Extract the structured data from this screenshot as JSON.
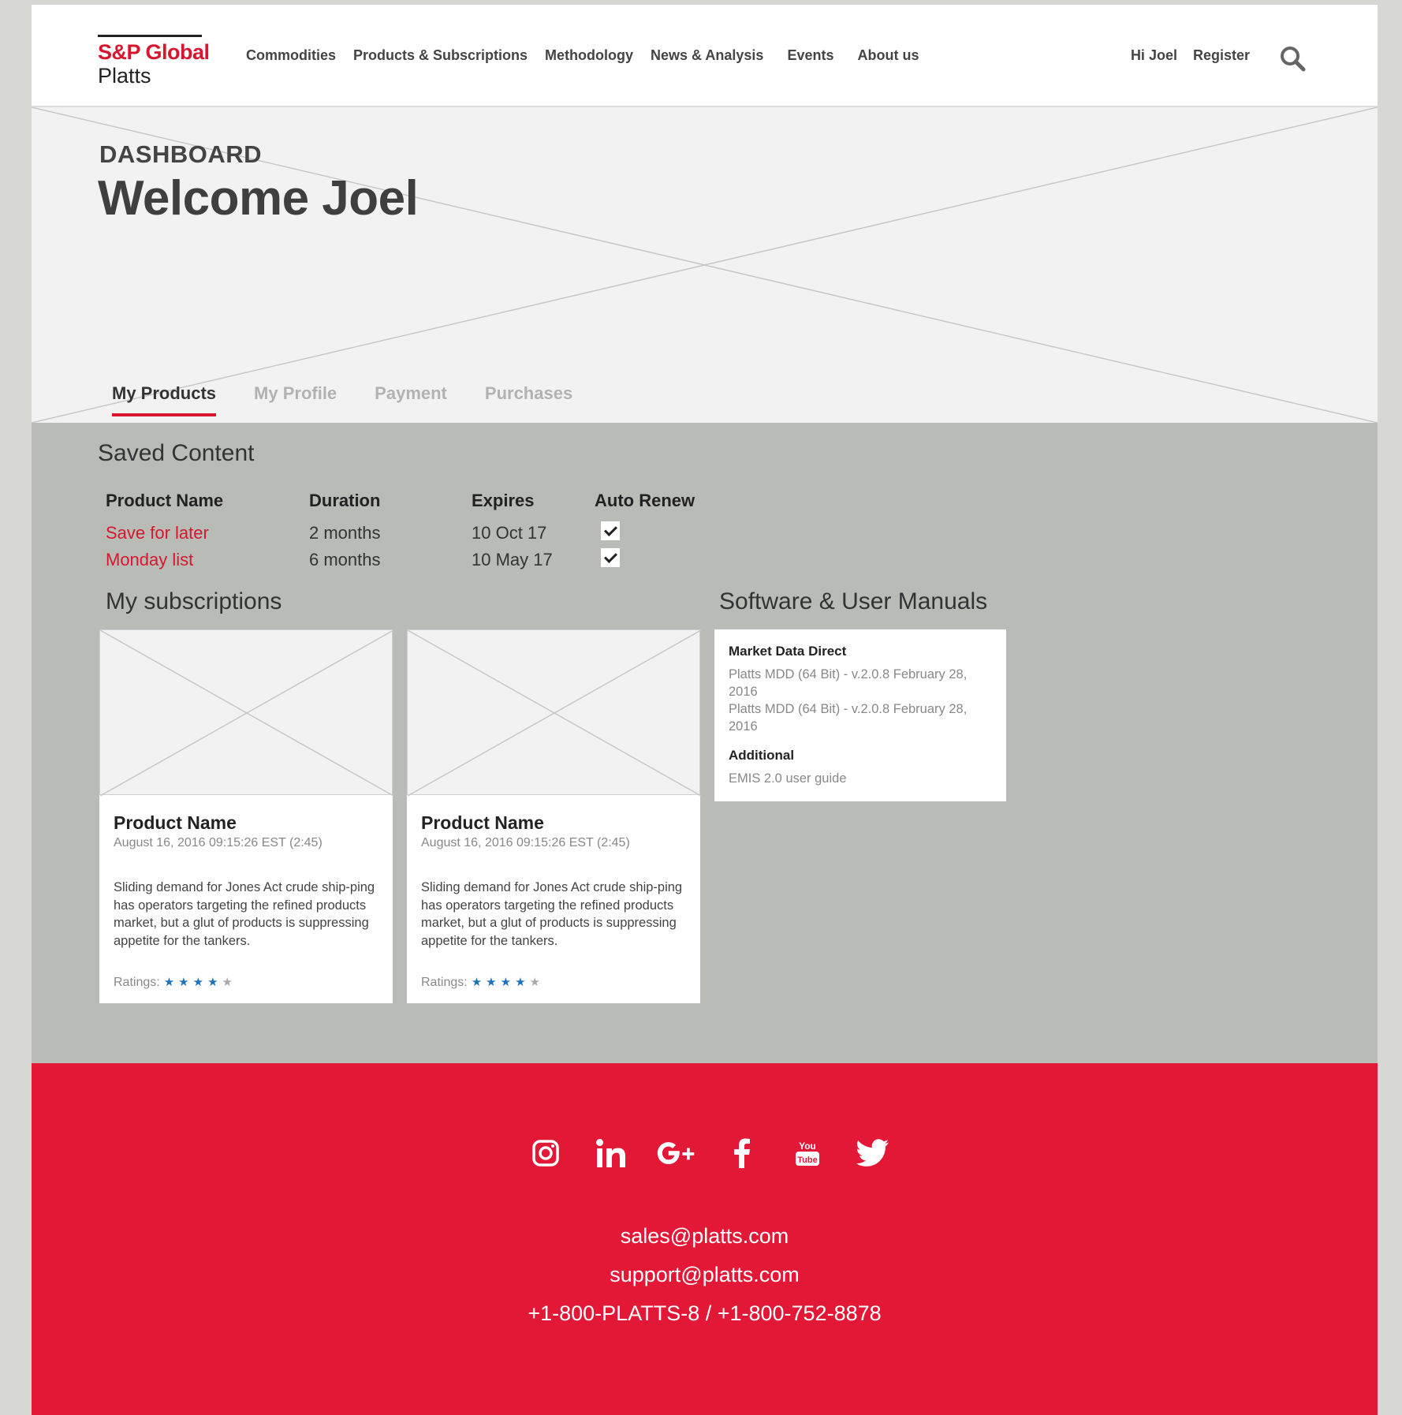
{
  "header": {
    "logo_line1": "S&P Global",
    "logo_line2": "Platts",
    "nav": [
      "Commodities",
      "Products & Subscriptions",
      "Methodology",
      "News & Analysis",
      "Events",
      "About us"
    ],
    "greeting": "Hi Joel",
    "register": "Register"
  },
  "hero": {
    "kicker": "DASHBOARD",
    "title": "Welcome Joel",
    "tabs": [
      "My Products",
      "My Profile",
      "Payment",
      "Purchases"
    ],
    "active_tab": "My Products"
  },
  "saved_content": {
    "title": "Saved Content",
    "columns": [
      "Product Name",
      "Duration",
      "Expires",
      "Auto Renew"
    ],
    "rows": [
      {
        "name": "Save for later",
        "duration": "2 months",
        "expires": "10 Oct 17",
        "auto_renew": true
      },
      {
        "name": "Monday list",
        "duration": "6 months",
        "expires": "10 May 17",
        "auto_renew": true
      }
    ]
  },
  "subscriptions": {
    "title": "My subscriptions",
    "cards": [
      {
        "name": "Product Name",
        "date": "August 16, 2016 09:15:26 EST (2:45)",
        "description": "Sliding demand for Jones Act crude ship-ping has operators targeting the refined products market, but a glut of products is suppressing appetite for the tankers.",
        "ratings_label": "Ratings:",
        "rating": 4,
        "rating_max": 5
      },
      {
        "name": "Product Name",
        "date": "August 16, 2016 09:15:26 EST (2:45)",
        "description": "Sliding demand for Jones Act crude ship-ping has operators targeting the refined products market, but a glut of products is suppressing appetite for the tankers.",
        "ratings_label": "Ratings:",
        "rating": 4,
        "rating_max": 5
      }
    ]
  },
  "manuals": {
    "title": "Software & User Manuals",
    "heading1": "Market Data Direct",
    "items1": [
      "Platts MDD (64 Bit) - v.2.0.8 February 28, 2016",
      "Platts MDD (64 Bit) - v.2.0.8 February 28, 2016"
    ],
    "heading2": "Additional",
    "items2": [
      "EMIS 2.0 user guide"
    ]
  },
  "footer": {
    "social": [
      "instagram-icon",
      "linkedin-icon",
      "google-plus-icon",
      "facebook-icon",
      "youtube-icon",
      "twitter-icon"
    ],
    "email_sales": "sales@platts.com",
    "email_support": "support@platts.com",
    "phone": "+1-800-PLATTS-8 / +1-800-752-8878"
  },
  "colors": {
    "brand_red": "#e31837",
    "accent_blue": "#1f72b8",
    "content_bg": "#b9bbb7"
  }
}
